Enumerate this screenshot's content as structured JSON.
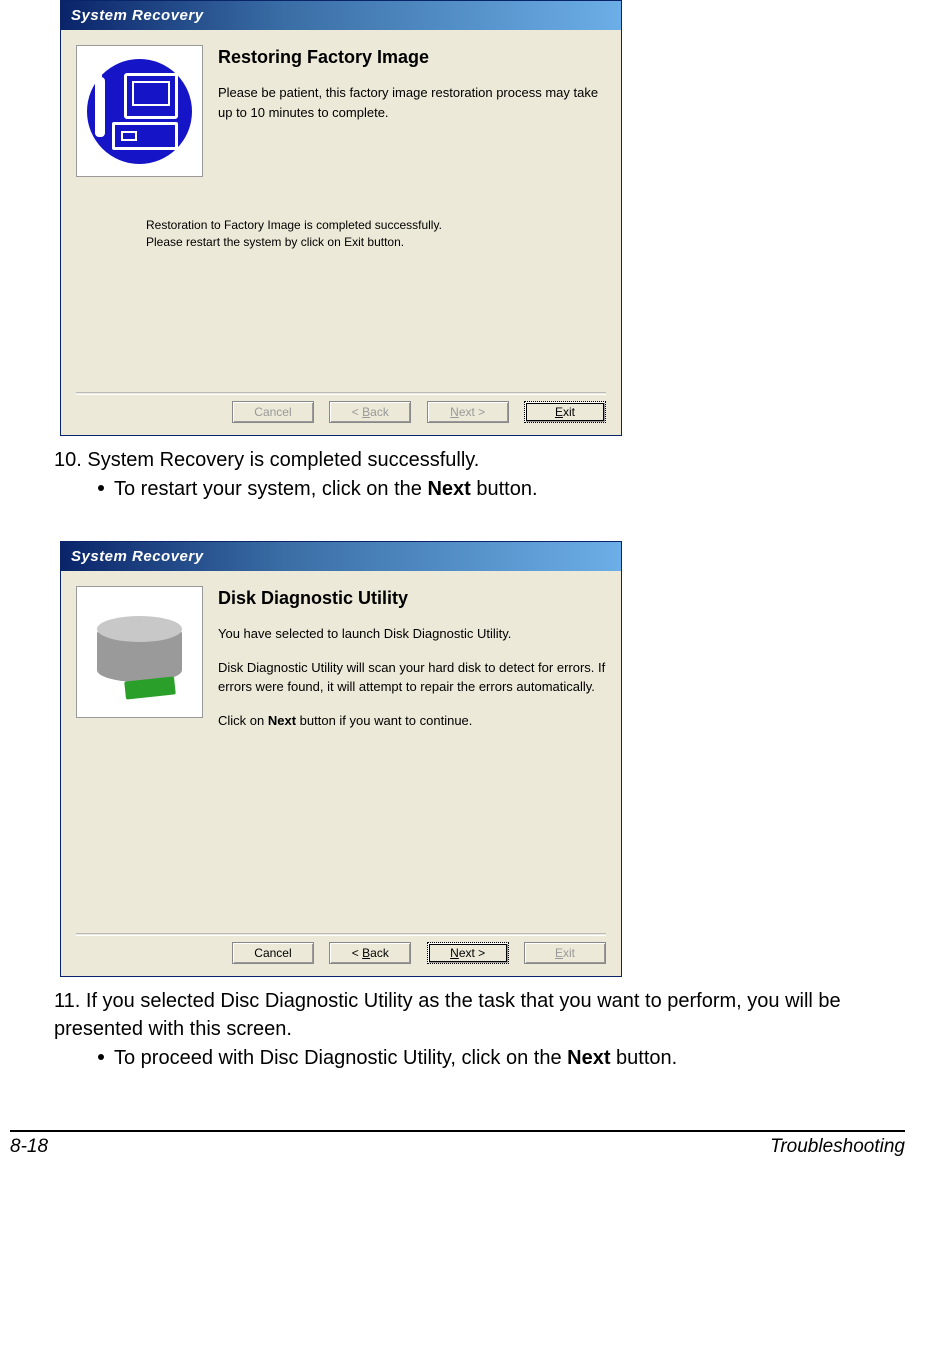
{
  "dialog1": {
    "title": "System Recovery",
    "heading": "Restoring Factory Image",
    "para1": "Please be patient, this factory image restoration process may take up to 10 minutes to complete.",
    "mid1": "Restoration to Factory Image is completed successfully.",
    "mid2": "Please restart the system by click on Exit button.",
    "buttons": {
      "cancel": "Cancel",
      "back_prefix": "< ",
      "back_u": "B",
      "back_rest": "ack",
      "next_u": "N",
      "next_rest": "ext >",
      "exit_u": "E",
      "exit_rest": "xit"
    }
  },
  "step10": {
    "num": "10.",
    "text": " System Recovery is completed successfully.",
    "bullet_pre": "To restart your system, click on the ",
    "bullet_bold": "Next",
    "bullet_post": " button."
  },
  "dialog2": {
    "title": "System Recovery",
    "heading": "Disk Diagnostic Utility",
    "para1": "You have selected to launch Disk Diagnostic Utility.",
    "para2": "Disk Diagnostic Utility will scan your hard disk to detect for errors. If errors were found, it will attempt to repair the errors automatically.",
    "para3_pre": "Click on ",
    "para3_bold": "Next",
    "para3_post": " button if you want to continue.",
    "buttons": {
      "cancel": "Cancel",
      "back_prefix": "< ",
      "back_u": "B",
      "back_rest": "ack",
      "next_u": "N",
      "next_rest": "ext >",
      "exit_u": "E",
      "exit_rest": "xit"
    }
  },
  "step11": {
    "num": "11.",
    "text": " If you selected Disc Diagnostic Utility as the task that you want to perform, you will be presented with this screen.",
    "bullet_pre": "To proceed with Disc Diagnostic Utility, click on the ",
    "bullet_bold": "Next",
    "bullet_post": " button."
  },
  "footer": {
    "left": "8-18",
    "right": "Troubleshooting"
  }
}
